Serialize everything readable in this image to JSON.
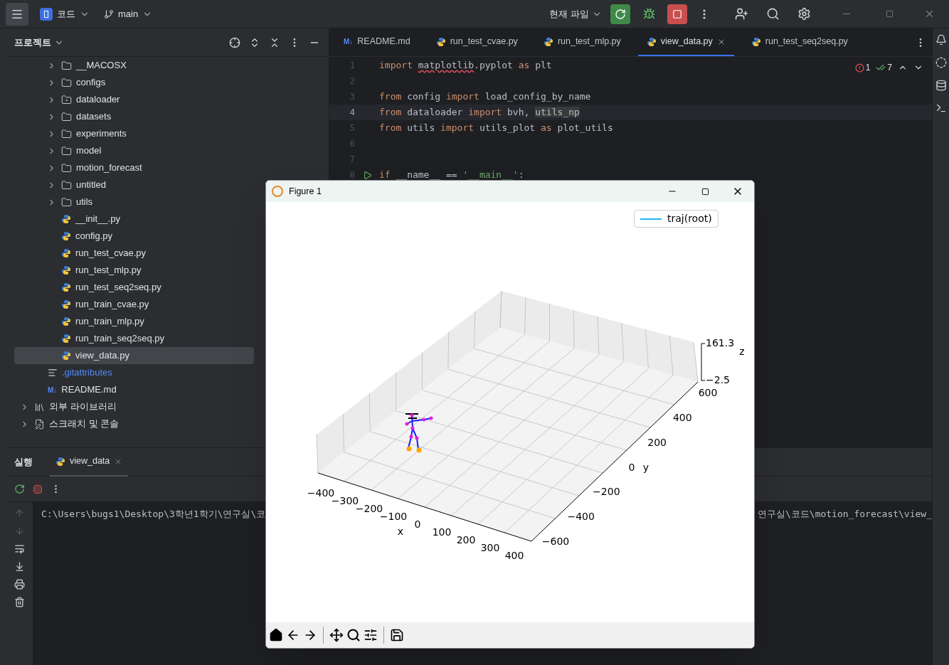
{
  "top_bar": {
    "project": "코드",
    "branch": "main",
    "run_config": "현재 파일"
  },
  "project_panel": {
    "title": "프로젝트",
    "tree": [
      {
        "children": [
          {
            "children": [
              {
                "label": "__MACOSX",
                "kind": "folder",
                "expanded": false,
                "selected": false
              },
              {
                "label": "configs",
                "kind": "folder",
                "expanded": false,
                "selected": false
              },
              {
                "label": "dataloader",
                "kind": "package",
                "expanded": false,
                "selected": false
              },
              {
                "label": "datasets",
                "kind": "folder",
                "expanded": false,
                "selected": false
              },
              {
                "label": "experiments",
                "kind": "folder",
                "expanded": false,
                "selected": false
              },
              {
                "label": "model",
                "kind": "folder",
                "expanded": false,
                "selected": false
              },
              {
                "label": "motion_forecast",
                "kind": "folder",
                "expanded": false,
                "selected": false
              },
              {
                "label": "untitled",
                "kind": "folder",
                "expanded": false,
                "selected": false
              },
              {
                "label": "utils",
                "kind": "folder",
                "expanded": false,
                "selected": false
              },
              {
                "label": "__init__.py",
                "kind": "python",
                "selected": false
              },
              {
                "label": "config.py",
                "kind": "python",
                "selected": false
              },
              {
                "label": "run_test_cvae.py",
                "kind": "python",
                "selected": false
              },
              {
                "label": "run_test_mlp.py",
                "kind": "python",
                "selected": false
              },
              {
                "label": "run_test_seq2seq.py",
                "kind": "python",
                "selected": false
              },
              {
                "label": "run_train_cvae.py",
                "kind": "python",
                "selected": false
              },
              {
                "label": "run_train_mlp.py",
                "kind": "python",
                "selected": false
              },
              {
                "label": "run_train_seq2seq.py",
                "kind": "python",
                "selected": false
              },
              {
                "label": "view_data.py",
                "kind": "python",
                "selected": true
              }
            ]
          },
          {
            "label": ".gitattributes",
            "kind": "text",
            "selected": false
          },
          {
            "label": "README.md",
            "kind": "markdown",
            "badge": "M↓",
            "selected": false
          }
        ]
      },
      {
        "label": "외부 라이브러리",
        "kind": "library",
        "expanded": false,
        "selected": false
      },
      {
        "label": "스크래치 및 콘솔",
        "kind": "scratch",
        "expanded": false,
        "selected": false
      }
    ]
  },
  "editor": {
    "tabs": [
      {
        "label": "README.md",
        "kind": "markdown",
        "badge": "M↓",
        "selected": false
      },
      {
        "label": "run_test_cvae.py",
        "kind": "python",
        "selected": false
      },
      {
        "label": "run_test_mlp.py",
        "kind": "python",
        "selected": false
      },
      {
        "label": "view_data.py",
        "kind": "python",
        "selected": true
      },
      {
        "label": "run_test_seq2seq.py",
        "kind": "python",
        "selected": false
      }
    ],
    "inspections": {
      "errors": "1",
      "checks": "7"
    },
    "lines": [
      {
        "number": "1",
        "current": false,
        "run": false,
        "tokens": [
          {
            "kind": "kw",
            "text": "import "
          },
          {
            "kind": "error",
            "text": "matplotlib"
          },
          {
            "kind": "plain",
            "text": ".pyplot "
          },
          {
            "kind": "kw",
            "text": "as"
          },
          {
            "kind": "plain",
            "text": " plt"
          }
        ]
      },
      {
        "number": "2",
        "current": false,
        "run": false
      },
      {
        "number": "3",
        "current": false,
        "run": false,
        "tokens": [
          {
            "kind": "kw",
            "text": "from"
          },
          {
            "kind": "plain",
            "text": " config "
          },
          {
            "kind": "kw",
            "text": "import"
          },
          {
            "kind": "plain",
            "text": " load_config_by_name"
          }
        ]
      },
      {
        "number": "4",
        "current": true,
        "run": false,
        "tokens": [
          {
            "kind": "kw",
            "text": "from"
          },
          {
            "kind": "plain",
            "text": " dataloader "
          },
          {
            "kind": "kw",
            "text": "import"
          },
          {
            "kind": "plain",
            "text": " bvh, "
          },
          {
            "kind": "highlight",
            "text": "utils_np"
          }
        ]
      },
      {
        "number": "5",
        "current": false,
        "run": false,
        "tokens": [
          {
            "kind": "kw",
            "text": "from"
          },
          {
            "kind": "plain",
            "text": " utils "
          },
          {
            "kind": "kw",
            "text": "import"
          },
          {
            "kind": "plain",
            "text": " utils_plot "
          },
          {
            "kind": "kw",
            "text": "as"
          },
          {
            "kind": "plain",
            "text": " plot_utils"
          }
        ]
      },
      {
        "number": "6",
        "current": false,
        "run": false
      },
      {
        "number": "7",
        "current": false,
        "run": false
      },
      {
        "number": "8",
        "current": false,
        "run": true,
        "tokens": [
          {
            "kind": "kw",
            "text": "if"
          },
          {
            "kind": "plain",
            "text": " __name__ == "
          },
          {
            "kind": "string",
            "text": "'__main__'"
          },
          {
            "kind": "plain",
            "text": ":"
          }
        ]
      }
    ]
  },
  "run_panel": {
    "title": "실행",
    "tab": "view_data",
    "console_left": "C:\\Users\\bugs1\\Desktop\\3학년1학기\\연구실\\코",
    "console_right": "연구실\\코드\\motion_forecast\\view_"
  },
  "figure": {
    "title": "Figure 1",
    "legend": "traj(root)",
    "x_label": "x",
    "y_label": "y",
    "z_label": "z",
    "x_ticks": [
      "−400",
      "−300",
      "−200",
      "−100",
      "0",
      "100",
      "200",
      "300",
      "400"
    ],
    "y_ticks": [
      "600",
      "400",
      "200",
      "0",
      "−200",
      "−400",
      "−600"
    ],
    "z_ticks": [
      "161.3",
      "−2.5"
    ]
  }
}
